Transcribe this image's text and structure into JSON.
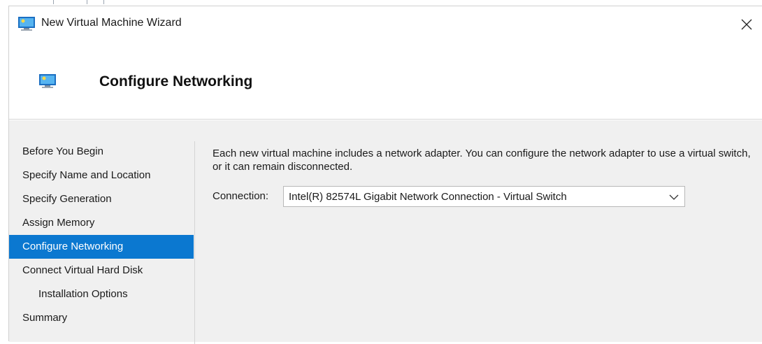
{
  "window": {
    "title": "New Virtual Machine Wizard",
    "icon": "virtual-machine-icon",
    "close_icon": "close-icon"
  },
  "header": {
    "title": "Configure Networking",
    "icon": "virtual-machine-icon"
  },
  "nav": {
    "items": [
      {
        "label": "Before You Begin",
        "active": false,
        "sub": false
      },
      {
        "label": "Specify Name and Location",
        "active": false,
        "sub": false
      },
      {
        "label": "Specify Generation",
        "active": false,
        "sub": false
      },
      {
        "label": "Assign Memory",
        "active": false,
        "sub": false
      },
      {
        "label": "Configure Networking",
        "active": true,
        "sub": false
      },
      {
        "label": "Connect Virtual Hard Disk",
        "active": false,
        "sub": false
      },
      {
        "label": "Installation Options",
        "active": false,
        "sub": true
      },
      {
        "label": "Summary",
        "active": false,
        "sub": false
      }
    ]
  },
  "content": {
    "description": "Each new virtual machine includes a network adapter. You can configure the network adapter to use a virtual switch, or it can remain disconnected.",
    "connection_label": "Connection:",
    "connection_value": "Intel(R) 82574L Gigabit Network Connection - Virtual Switch"
  },
  "colors": {
    "accent": "#0b78d0",
    "body_bg": "#f0f0f0"
  }
}
